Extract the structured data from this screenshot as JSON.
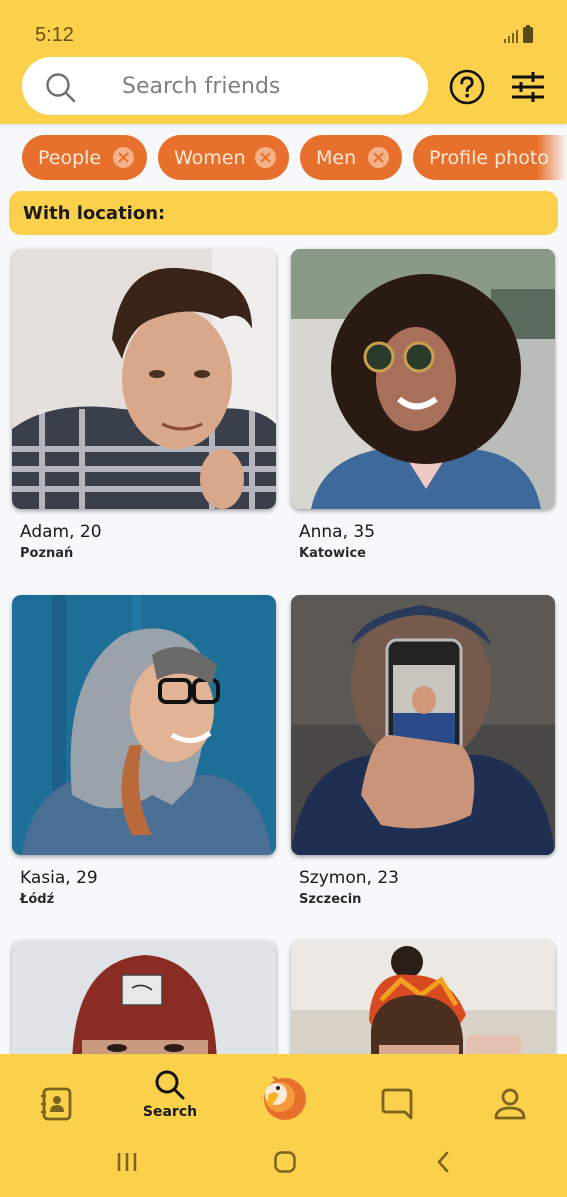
{
  "status_bar": {
    "time": "5:12"
  },
  "search": {
    "placeholder": "Search friends",
    "value": ""
  },
  "header_actions": {
    "help_icon": "help-circle-icon",
    "filter_icon": "sliders-icon"
  },
  "filter_chips": [
    {
      "label": "People"
    },
    {
      "label": "Women"
    },
    {
      "label": "Men"
    },
    {
      "label": "Profile photo"
    }
  ],
  "section": {
    "title": "With location:"
  },
  "profiles": [
    {
      "name": "Adam, 20",
      "city": "Poznań"
    },
    {
      "name": "Anna, 35",
      "city": "Katowice"
    },
    {
      "name": "Kasia, 29",
      "city": "Łódź"
    },
    {
      "name": "Szymon, 23",
      "city": "Szczecin"
    },
    {
      "name": "",
      "city": ""
    },
    {
      "name": "",
      "city": ""
    }
  ],
  "bottom_nav": {
    "items": [
      {
        "icon": "contacts-icon",
        "label": ""
      },
      {
        "icon": "search-icon",
        "label": "Search",
        "active": true
      },
      {
        "icon": "parrot-logo-icon",
        "label": ""
      },
      {
        "icon": "chat-icon",
        "label": ""
      },
      {
        "icon": "profile-icon",
        "label": ""
      }
    ]
  },
  "colors": {
    "primary": "#fbd04a",
    "chip": "#e8702d",
    "background": "#f7f8fa"
  }
}
